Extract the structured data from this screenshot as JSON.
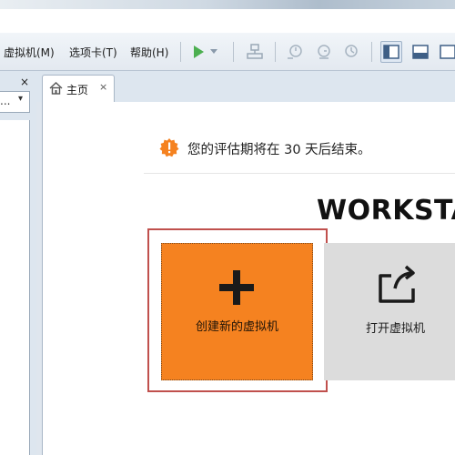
{
  "menu": {
    "items": [
      "虚拟机(M)",
      "选项卡(T)",
      "帮助(H)"
    ]
  },
  "toolbar": {
    "icons": [
      "play-icon",
      "play-dropdown-icon",
      "network-icon",
      "snapshot-icon",
      "snapshot-revert-icon",
      "snapshot-manager-icon",
      "library-view-icon",
      "console-view-icon",
      "fullscreen-icon"
    ]
  },
  "library": {
    "close_glyph": "×",
    "search_dots": "...",
    "dropdown_glyph": "▾"
  },
  "tabs": [
    {
      "label": "主页",
      "close_glyph": "×"
    }
  ],
  "home": {
    "evaluation_notice": "您的评估期将在 30 天后结束。",
    "brand": "WORKSTA",
    "tiles": {
      "create": {
        "label": "创建新的虚拟机"
      },
      "open": {
        "label": "打开虚拟机"
      }
    }
  },
  "colors": {
    "accent_orange": "#F58220",
    "tile_grey": "#DCDCDC",
    "highlight_red": "#C0504D",
    "play_green": "#4CAF50"
  }
}
